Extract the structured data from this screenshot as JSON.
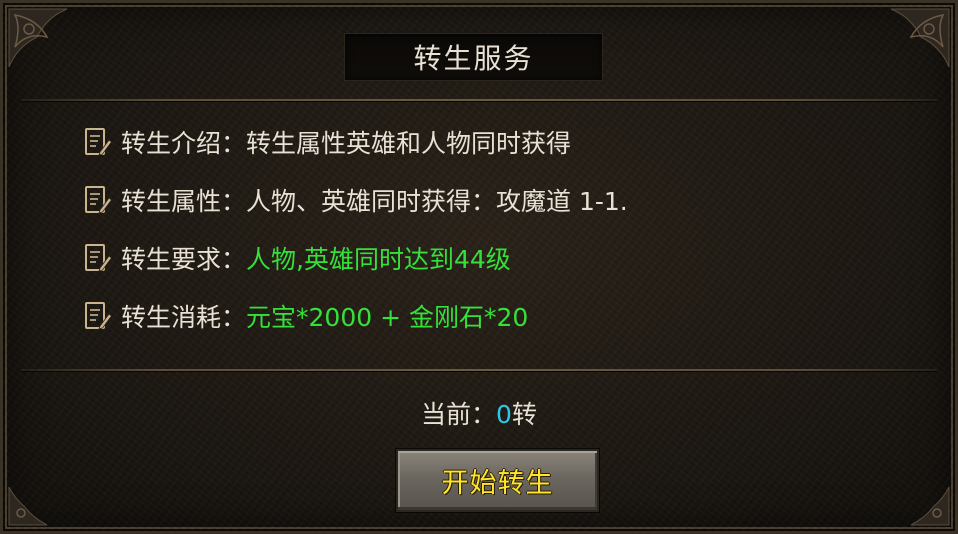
{
  "window": {
    "title": "转生服务"
  },
  "info": [
    {
      "label": "转生介绍：",
      "value": "转生属性英雄和人物同时获得",
      "color": "white"
    },
    {
      "label": "转生属性：",
      "value": "人物、英雄同时获得：攻魔道 1-1.",
      "color": "white"
    },
    {
      "label": "转生要求：",
      "value": "人物,英雄同时达到44级",
      "color": "green"
    },
    {
      "label": "转生消耗：",
      "value": "元宝*2000 + 金刚石*20",
      "color": "green"
    }
  ],
  "status": {
    "label": "当前：",
    "count": "0",
    "unit": "转"
  },
  "actions": {
    "start_label": "开始转生"
  },
  "icons": {
    "row_icon": "note-pencil-icon",
    "corner_ornament": "ornament-corner-icon"
  },
  "colors": {
    "text": "#e8e1d4",
    "green": "#35e03b",
    "cyan": "#2ec7e8",
    "button_text": "#ffe62b"
  }
}
